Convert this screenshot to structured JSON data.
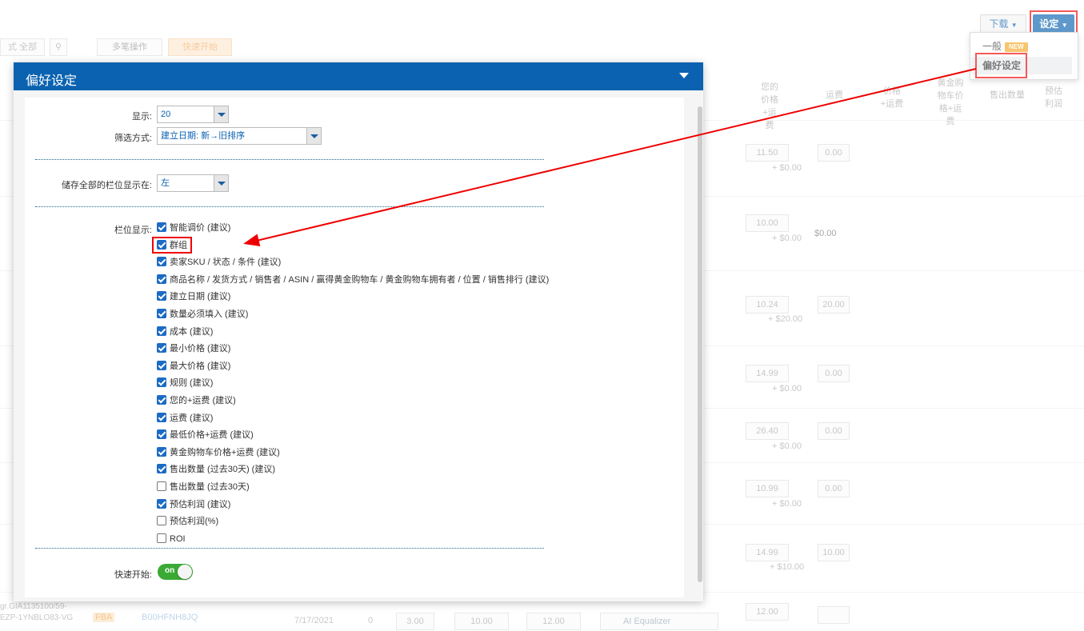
{
  "toolbar": {
    "download_label": "下载",
    "settings_label": "设定",
    "multi_action_label": "多笔操作",
    "quick_start_label": "快速开始",
    "filter_label": "式 全部"
  },
  "settings_menu": {
    "general_label": "一般",
    "new_badge": "NEW",
    "preferences_label": "偏好设定"
  },
  "bg_headers": [
    "您的价格+运费",
    "运费",
    "价格+运费",
    "黄金购物车价格+运费",
    "售出数量",
    "预估利润"
  ],
  "bg_rows": [
    {
      "price": "11.50",
      "ship": "+ $0.00",
      "fee": "0.00"
    },
    {
      "price": "10.00",
      "ship": "+ $0.00",
      "fee": "$0.00"
    },
    {
      "price": "10.24",
      "ship": "+ $20.00",
      "fee": "20.00"
    },
    {
      "price": "14.99",
      "ship": "+ $0.00",
      "fee": "0.00"
    },
    {
      "price": "26.40",
      "ship": "+ $0.00",
      "fee": "0.00"
    },
    {
      "price": "10.99",
      "ship": "+ $0.00",
      "fee": "0.00"
    },
    {
      "price": "14.99",
      "ship": "+ $10.00",
      "fee": "10.00"
    },
    {
      "price": "12.00",
      "ship": "",
      "fee": ""
    }
  ],
  "bg_last_row": {
    "sku": "gr.GIA1135100/59-EZP-1YNBLO83-VG",
    "fba": "FBA",
    "asin": "B00HFNH8JQ",
    "date": "7/17/2021",
    "qty": "0",
    "v1": "3.00",
    "v2": "10.00",
    "v3": "12.00",
    "rule": "AI Equalizer"
  },
  "modal": {
    "title": "偏好设定",
    "display_label": "显示:",
    "display_value": "20",
    "sort_label": "筛选方式:",
    "sort_value": "建立日期: 新→旧排序",
    "save_columns_label": "储存全部的栏位显示在:",
    "save_columns_value": "左",
    "columns_label": "栏位显示:",
    "columns": [
      {
        "label": "智能调价 (建议)",
        "checked": true
      },
      {
        "label": "群组",
        "checked": true
      },
      {
        "label": "卖家SKU / 状态 / 条件 (建议)",
        "checked": true
      },
      {
        "label": "商品名称 / 发货方式 / 销售者 / ASIN / 赢得黄金购物车 / 黄金购物车拥有者 / 位置 / 销售排行 (建议)",
        "checked": true
      },
      {
        "label": "建立日期 (建议)",
        "checked": true
      },
      {
        "label": "数量必须填入 (建议)",
        "checked": true
      },
      {
        "label": "成本 (建议)",
        "checked": true
      },
      {
        "label": "最小价格 (建议)",
        "checked": true
      },
      {
        "label": "最大价格 (建议)",
        "checked": true
      },
      {
        "label": "规则 (建议)",
        "checked": true
      },
      {
        "label": "您的+运费 (建议)",
        "checked": true
      },
      {
        "label": "运费 (建议)",
        "checked": true
      },
      {
        "label": "最低价格+运费 (建议)",
        "checked": true
      },
      {
        "label": "黄金购物车价格+运费 (建议)",
        "checked": true
      },
      {
        "label": "售出数量 (过去30天) (建议)",
        "checked": true
      },
      {
        "label": "售出数量 (过去30天)",
        "checked": false
      },
      {
        "label": "预估利润 (建议)",
        "checked": true
      },
      {
        "label": "预估利润(%)",
        "checked": false
      },
      {
        "label": "ROI",
        "checked": false
      }
    ],
    "quick_start_label": "快速开始:",
    "quick_start_toggle": "on"
  },
  "colors": {
    "primary": "#0a62b0",
    "highlight": "#e00000",
    "toggle_on": "#3aaa35",
    "badge": "#f5a623"
  }
}
